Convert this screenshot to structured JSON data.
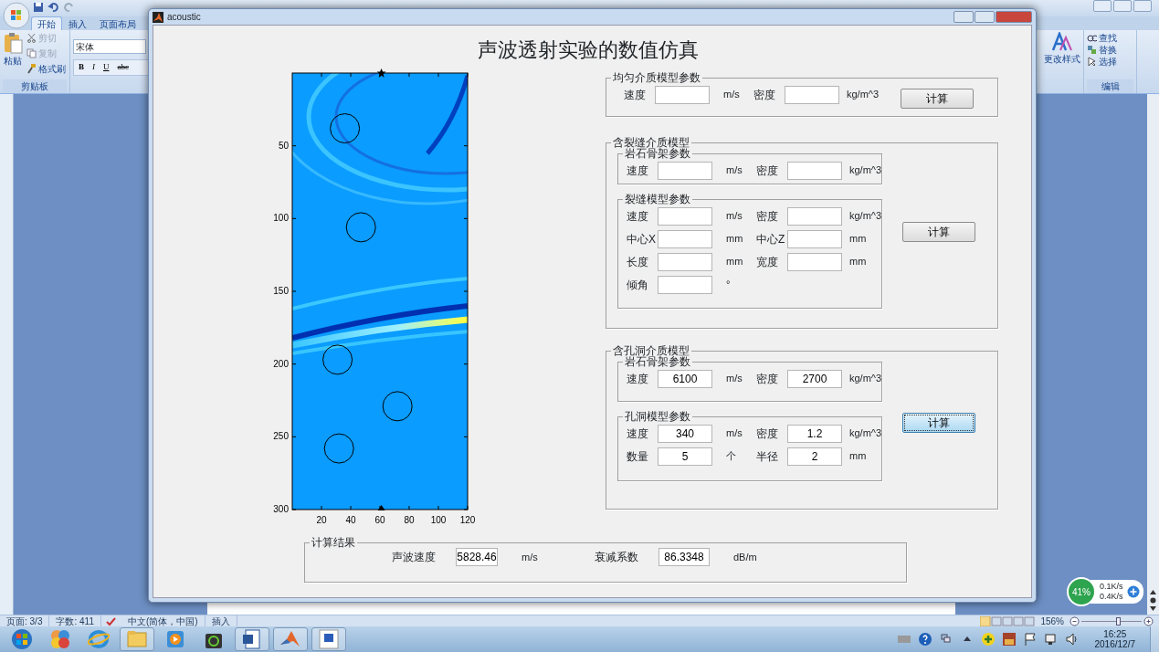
{
  "word": {
    "ribbon_tabs": [
      {
        "label": "开始",
        "selected": true
      },
      {
        "label": "插入",
        "selected": false
      },
      {
        "label": "页面布局",
        "selected": false
      }
    ],
    "clipboard": {
      "paste": "粘贴",
      "group": "剪贴板",
      "items": [
        {
          "kind": "cut",
          "label": "剪切",
          "disabled": true
        },
        {
          "kind": "copy",
          "label": "复制",
          "disabled": true
        },
        {
          "kind": "painter",
          "label": "格式刷",
          "disabled": false
        }
      ]
    },
    "font_name": "宋体",
    "format_buttons": [
      "B",
      "I",
      "U",
      "abc"
    ],
    "change_styles": "更改样式",
    "editing": {
      "group": "编辑",
      "items": [
        {
          "kind": "find",
          "label": "查找"
        },
        {
          "kind": "replace",
          "label": "替换"
        },
        {
          "kind": "select",
          "label": "选择"
        }
      ]
    },
    "status_bar": {
      "page": "页面: 3/3",
      "words": "字数: 411",
      "language": "中文(简体，中国)",
      "mode": "插入",
      "zoom": "156%",
      "zoom_slider": {
        "level": 0.6
      }
    }
  },
  "figure": {
    "title": "acoustic",
    "heading": "声波透射实验的数值仿真",
    "plot": {
      "xticks": [
        "20",
        "40",
        "60",
        "80",
        "100",
        "120"
      ],
      "yticks": [
        "50",
        "100",
        "150",
        "200",
        "250",
        "300"
      ]
    },
    "panels": [
      {
        "kind": "params",
        "title": "均匀介质模型参数",
        "rows": [
          [
            {
              "label": "速度",
              "unit": "m/s"
            },
            {
              "label": "密度",
              "unit": "kg/m^3"
            }
          ]
        ],
        "button": {
          "label": "计算",
          "focused": false
        }
      },
      {
        "kind": "groups",
        "title": "含裂缝介质模型",
        "groups": [
          {
            "title": "岩石骨架参数",
            "rows": [
              [
                {
                  "label": "速度",
                  "unit": "m/s"
                },
                {
                  "label": "密度",
                  "unit": "kg/m^3"
                }
              ]
            ]
          },
          {
            "title": "裂缝模型参数",
            "rows": [
              [
                {
                  "label": "速度",
                  "unit": "m/s"
                },
                {
                  "label": "密度",
                  "unit": "kg/m^3"
                }
              ],
              [
                {
                  "label": "中心X",
                  "unit": "mm"
                },
                {
                  "label": "中心Z",
                  "unit": "mm"
                }
              ],
              [
                {
                  "label": "长度",
                  "unit": "mm"
                },
                {
                  "label": "宽度",
                  "unit": "mm"
                }
              ],
              [
                {
                  "label": "倾角",
                  "unit": "°"
                }
              ]
            ]
          }
        ],
        "button": {
          "label": "计算",
          "focused": false
        }
      },
      {
        "kind": "groups",
        "title": "含孔洞介质模型",
        "groups": [
          {
            "title": "岩石骨架参数",
            "rows": [
              [
                {
                  "label": "速度",
                  "value": "6100",
                  "unit": "m/s"
                },
                {
                  "label": "密度",
                  "value": "2700",
                  "unit": "kg/m^3"
                }
              ]
            ]
          },
          {
            "title": "孔洞模型参数",
            "rows": [
              [
                {
                  "label": "速度",
                  "value": "340",
                  "unit": "m/s"
                },
                {
                  "label": "密度",
                  "value": "1.2",
                  "unit": "kg/m^3"
                }
              ],
              [
                {
                  "label": "数量",
                  "value": "5",
                  "unit": "个"
                },
                {
                  "label": "半径",
                  "value": "2",
                  "unit": "mm"
                }
              ]
            ]
          }
        ],
        "button": {
          "label": "计算",
          "focused": true
        }
      }
    ],
    "result": {
      "title": "计算结果",
      "items": [
        {
          "label": "声波速度",
          "value": "5828.46",
          "unit": "m/s"
        },
        {
          "label": "衰减系数",
          "value": "86.3348",
          "unit": "dB/m"
        }
      ]
    }
  },
  "net_widget": {
    "percent": "41%",
    "up": "0.1K/s",
    "down": "0.4K/s"
  },
  "taskbar": {
    "time": "16:25",
    "date": "2016/12/7"
  }
}
